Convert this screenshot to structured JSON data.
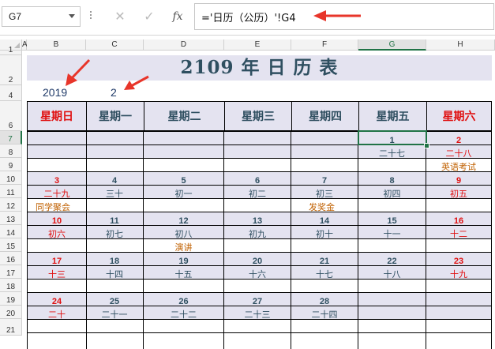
{
  "name_box": "G7",
  "formula": "='日历（公历）'!G4",
  "columns": [
    "A",
    "B",
    "C",
    "D",
    "E",
    "F",
    "G",
    "H"
  ],
  "rows": [
    "1",
    "2",
    "4",
    "6",
    "7",
    "8",
    "9",
    "10",
    "11",
    "12",
    "13",
    "14",
    "15",
    "16",
    "17",
    "18",
    "19",
    "20",
    "21"
  ],
  "title": "2109 年 日 历 表",
  "year": "2019",
  "month": "2",
  "weekdays": [
    "星期日",
    "星期一",
    "星期二",
    "星期三",
    "星期四",
    "星期五",
    "星期六"
  ],
  "weeks": [
    {
      "days": [
        "",
        "",
        "",
        "",
        "",
        "1",
        "2"
      ],
      "lunar": [
        "",
        "",
        "",
        "",
        "",
        "二十七",
        "二十八"
      ],
      "events": [
        "",
        "",
        "",
        "",
        "",
        "",
        "英语考试"
      ]
    },
    {
      "days": [
        "3",
        "4",
        "5",
        "6",
        "7",
        "8",
        "9"
      ],
      "lunar": [
        "二十九",
        "三十",
        "初一",
        "初二",
        "初三",
        "初四",
        "初五"
      ],
      "events": [
        "同学聚会",
        "",
        "",
        "",
        "发奖金",
        "",
        ""
      ]
    },
    {
      "days": [
        "10",
        "11",
        "12",
        "13",
        "14",
        "15",
        "16"
      ],
      "lunar": [
        "初六",
        "初七",
        "初八",
        "初九",
        "初十",
        "十一",
        "十二"
      ],
      "events": [
        "",
        "",
        "演讲",
        "",
        "",
        "",
        ""
      ]
    },
    {
      "days": [
        "17",
        "18",
        "19",
        "20",
        "21",
        "22",
        "23"
      ],
      "lunar": [
        "十三",
        "十四",
        "十五",
        "十六",
        "十七",
        "十八",
        "十九"
      ],
      "events": [
        "",
        "",
        "",
        "",
        "",
        "",
        ""
      ]
    },
    {
      "days": [
        "24",
        "25",
        "26",
        "27",
        "28",
        "",
        ""
      ],
      "lunar": [
        "二十",
        "二十一",
        "二十二",
        "二十三",
        "二十四",
        "",
        ""
      ],
      "events": [
        "",
        "",
        "",
        "",
        "",
        "",
        ""
      ]
    }
  ],
  "colors": {
    "header_band": "#e4e3f0",
    "text": "#2f4f60",
    "weekend": "#e01010",
    "event": "#c06000",
    "selection": "#217346",
    "arrow": "#e8352a"
  }
}
